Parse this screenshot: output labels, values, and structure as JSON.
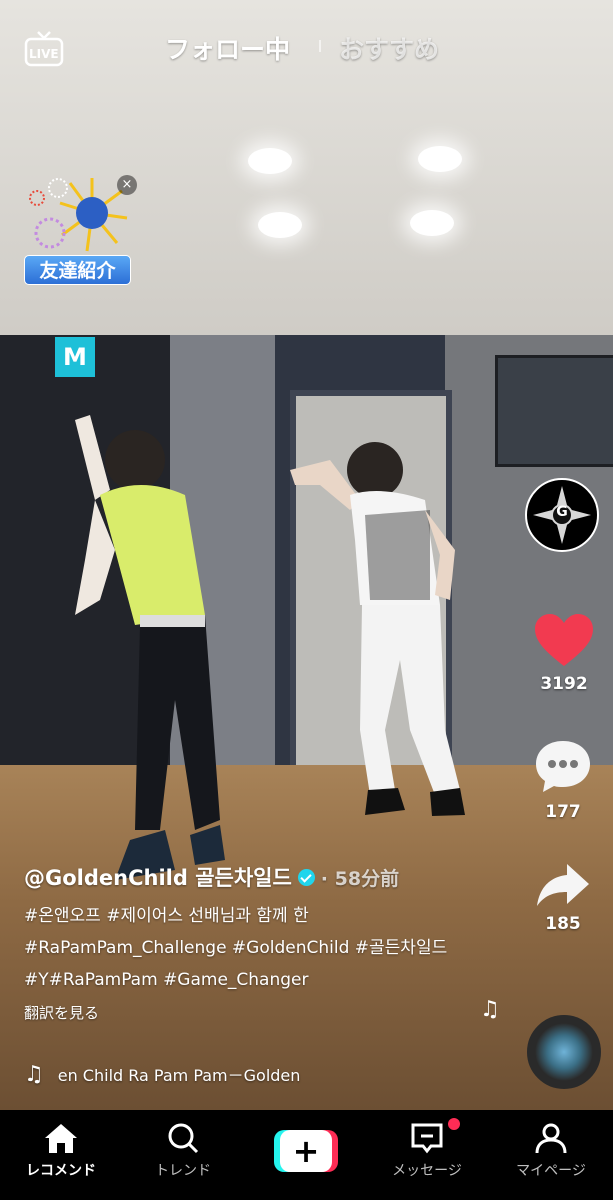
{
  "top_nav": {
    "live_label": "LIVE",
    "following_tab": "フォロー中",
    "for_you_tab": "おすすめ"
  },
  "friend_badge": {
    "label": "友達紹介",
    "close": "×"
  },
  "video": {
    "exit_sign": "M"
  },
  "side_actions": {
    "avatar_letter": "G",
    "likes": "3192",
    "comments": "177",
    "shares": "185"
  },
  "caption": {
    "author": "@GoldenChild 골든차일드",
    "time": "· 58分前",
    "lines": [
      "#온앤오프 #제이어스 선배님과 함께 한",
      "#RaPamPam_Challenge #GoldenChild #골든차일드",
      "#Y#RaPamPam #Game_Changer"
    ],
    "translate": "翻訳を見る"
  },
  "music": {
    "text": "en Child    Ra Pam Pam－Golden"
  },
  "bottom_nav": {
    "items": [
      {
        "label": "レコメンド",
        "icon": "home-icon"
      },
      {
        "label": "トレンド",
        "icon": "search-icon"
      },
      {
        "label": "",
        "icon": "plus-icon"
      },
      {
        "label": "メッセージ",
        "icon": "inbox-icon"
      },
      {
        "label": "マイページ",
        "icon": "profile-icon"
      }
    ]
  },
  "colors": {
    "accent_red": "#fe2c55",
    "accent_cyan": "#25f4ee",
    "like_red": "#f23a50",
    "verified_blue": "#20d5ec"
  }
}
